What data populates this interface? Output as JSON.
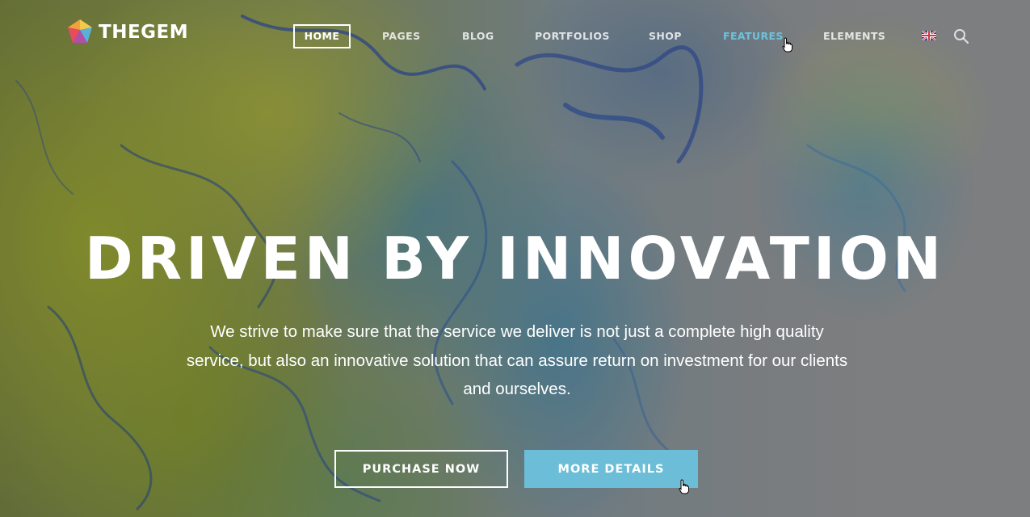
{
  "brand": {
    "name": "THEGEM",
    "logo_colors": [
      "#f5c84c",
      "#e84c5c",
      "#b04fa8",
      "#5ab0d6"
    ]
  },
  "nav": {
    "items": [
      {
        "label": "HOME",
        "state": "active"
      },
      {
        "label": "PAGES",
        "state": "normal"
      },
      {
        "label": "BLOG",
        "state": "normal"
      },
      {
        "label": "PORTFOLIOS",
        "state": "normal"
      },
      {
        "label": "SHOP",
        "state": "normal"
      },
      {
        "label": "FEATURES",
        "state": "hover"
      },
      {
        "label": "ELEMENTS",
        "state": "normal"
      }
    ],
    "language_icon": "uk-flag-icon",
    "search_icon": "search-icon"
  },
  "hero": {
    "title": "DRIVEN BY INNOVATION",
    "text_lines": [
      "We strive to make sure that the service we deliver is not just a complete high quality",
      "service, but also an innovative solution that can assure return on investment for our clients",
      "and ourselves."
    ],
    "primary_button": "PURCHASE NOW",
    "secondary_button": "MORE DETAILS"
  },
  "colors": {
    "accent": "#6cbdd8",
    "nav_hover": "#6cc3dc",
    "text": "#ffffff"
  }
}
